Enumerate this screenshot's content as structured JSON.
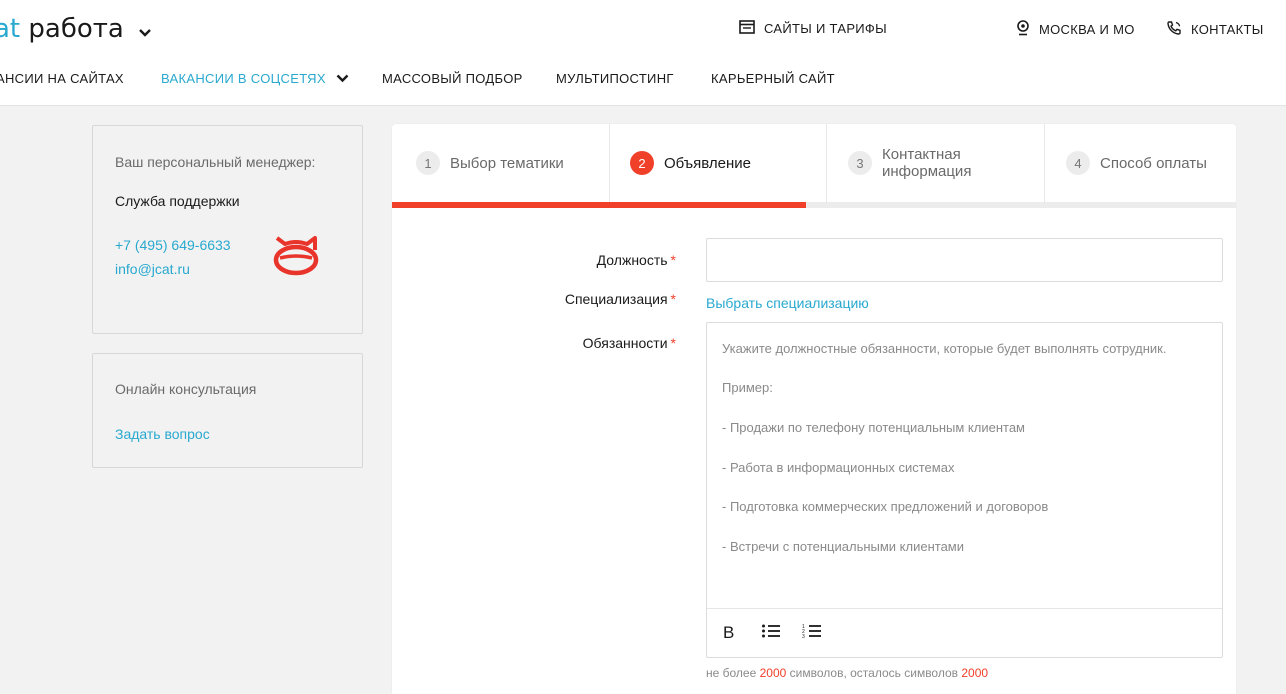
{
  "header": {
    "logo_brand": "at",
    "logo_text": "работа",
    "sites_tariffs": "САЙТЫ И ТАРИФЫ",
    "region": "МОСКВА И МО",
    "contacts": "КОНТАКТЫ"
  },
  "nav": {
    "items": [
      {
        "label": "АНСИИ НА САЙТАХ"
      },
      {
        "label": "ВАКАНСИИ В СОЦСЕТЯХ"
      },
      {
        "label": "МАССОВЫЙ ПОДБОР"
      },
      {
        "label": "МУЛЬТИПОСТИНГ"
      },
      {
        "label": "КАРЬЕРНЫЙ САЙТ"
      }
    ]
  },
  "manager": {
    "title": "Ваш персональный менеджер:",
    "name": "Служба поддержки",
    "phone": "+7 (495) 649-6633",
    "email": "info@jcat.ru"
  },
  "consult": {
    "title": "Онлайн консультация",
    "link": "Задать вопрос"
  },
  "steps": [
    {
      "num": "1",
      "label": "Выбор тематики"
    },
    {
      "num": "2",
      "label": "Объявление"
    },
    {
      "num": "3",
      "label_line1": "Контактная",
      "label_line2": "информация"
    },
    {
      "num": "4",
      "label": "Способ оплаты"
    }
  ],
  "progress": 0.5,
  "form": {
    "position_label": "Должность",
    "position_value": "",
    "spec_label": "Специализация",
    "spec_link": "Выбрать специализацию",
    "duties_label": "Обязанности",
    "required_mark": "*",
    "duties_placeholder": [
      "Укажите должностные обязанности, которые будет выполнять сотрудник.",
      "Пример:",
      "- Продажи по телефону потенциальным клиентам",
      "- Работа в информационных системах",
      "- Подготовка коммерческих предложений и договоров",
      "- Встречи с потенциальными клиентами"
    ],
    "bold": "B",
    "limit_pre": "не более",
    "limit_max": "2000",
    "limit_mid": "символов, осталось символов",
    "limit_left": "2000"
  },
  "colors": {
    "accent": "#29a9cf",
    "active": "#f0402a"
  }
}
